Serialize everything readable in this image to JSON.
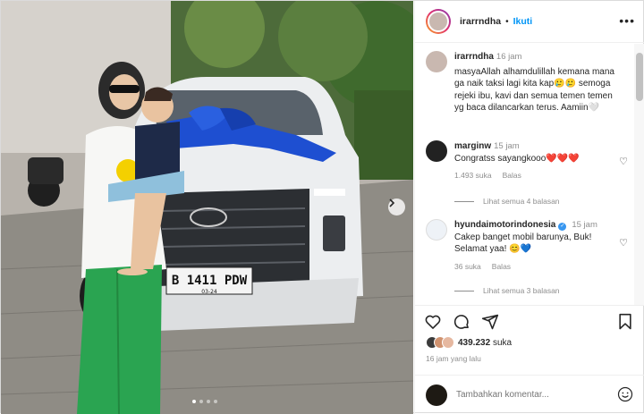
{
  "post": {
    "username": "irarrndha",
    "follow_label": "Ikuti",
    "more_label": "•••",
    "separator": "•"
  },
  "caption": {
    "username": "irarrndha",
    "time": "16 jam",
    "text": "masyaAllah alhamdulillah kemana mana ga naik taksi lagi kita kap🥲🥲 semoga rejeki ibu, kavi dan semua temen temen yg baca dilancarkan terus. Aamiin🤍"
  },
  "comments": [
    {
      "username": "marginw",
      "time": "15 jam",
      "text": "Congratss sayangkooo❤️❤️❤️",
      "likes": "1.493 suka",
      "reply_label": "Balas",
      "view_replies": "Lihat semua 4 balasan",
      "verified": false
    },
    {
      "username": "hyundaimotorindonesia",
      "time": "15 jam",
      "text": "Cakep banget mobil barunya, Buk! Selamat yaa! 😊💙",
      "likes": "36 suka",
      "reply_label": "Balas",
      "view_replies": "Lihat semua 3 balasan",
      "verified": true
    }
  ],
  "engagement": {
    "likes_count": "439.232",
    "likes_suffix": "suka",
    "posted": "16 jam yang lalu"
  },
  "add_comment": {
    "placeholder": "Tambahkan komentar..."
  },
  "photo": {
    "plate_number": "B 1411 PDW",
    "plate_expiry": "03-24",
    "carousel_total": 4,
    "carousel_index": 0
  },
  "icons": {
    "heart": "heart-icon",
    "comment": "comment-icon",
    "share": "share-icon",
    "bookmark": "bookmark-icon",
    "emoji": "emoji-icon",
    "chevron": "chevron-right-icon"
  },
  "colors": {
    "accent": "#0095f6",
    "heart_red": "#ed4956",
    "muted": "#8e8e8e"
  }
}
